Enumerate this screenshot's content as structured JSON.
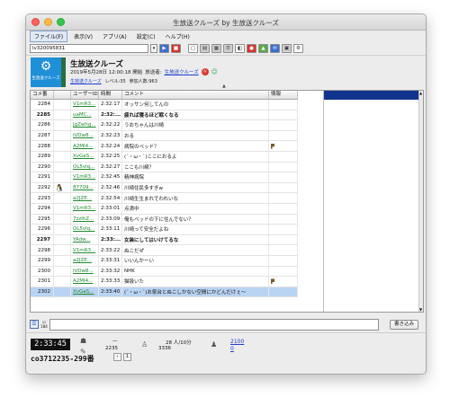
{
  "window": {
    "title": "生放送クルーズ by 生放送クルーズ"
  },
  "menu": [
    "ファイル(F)",
    "表示(V)",
    "アプリ(A)",
    "設定(C)",
    "ヘルプ(H)"
  ],
  "toolbar": {
    "live_id": "lv320095831"
  },
  "program": {
    "title": "生放送クルーズ",
    "thumb_label": "生放送クルーズ",
    "start": "2019年5月28日 12:00:18 開始",
    "broadcaster_label": "放送者:",
    "broadcaster": "生放送クルーズ",
    "community": "生放送クルーズ",
    "level": "レベル:35",
    "viewers": "参加人数:963"
  },
  "table": {
    "headers": [
      "コメ番",
      "ユーザーID",
      "時間",
      "コメント",
      "情報"
    ],
    "rows": [
      {
        "no": "2284",
        "uid": "V1mR3...",
        "time": "2:32:17",
        "comment": "オッサン何してんの",
        "bold": false,
        "mark": false
      },
      {
        "no": "2285",
        "uid": "uaMC...",
        "time": "2:32:...",
        "comment": "疲れば寝るほど眠くなる",
        "bold": true,
        "mark": false
      },
      {
        "no": "2286",
        "uid": "JgZwhg...",
        "time": "2:32:22",
        "comment": "うおちゃんは川崎",
        "bold": false,
        "mark": false
      },
      {
        "no": "2287",
        "uid": "iVDw8...",
        "time": "2:32:23",
        "comment": "おる",
        "bold": false,
        "mark": false
      },
      {
        "no": "2288",
        "uid": "A2MI4...",
        "time": "2:32:24",
        "comment": "病院のベッド？",
        "bold": false,
        "mark": true
      },
      {
        "no": "2289",
        "uid": "XvGaS...",
        "time": "2:32:25",
        "comment": "(´・ω・`)ここにおるよ",
        "bold": false,
        "mark": false
      },
      {
        "no": "2290",
        "uid": "OL5vlq...",
        "time": "2:32:27",
        "comment": "ここも川崎？",
        "bold": false,
        "mark": false
      },
      {
        "no": "2291",
        "uid": "V1mR3...",
        "time": "2:32:45",
        "comment": "精神病院",
        "bold": false,
        "mark": false
      },
      {
        "no": "2292",
        "uid": "87709...",
        "time": "2:32:46",
        "comment": "川崎住民多すぎw",
        "bold": false,
        "mark": false,
        "avatar": true
      },
      {
        "no": "2293",
        "uid": "a2JZE...",
        "time": "2:32:54",
        "comment": "川崎生生まれでわれいな",
        "bold": false,
        "mark": false
      },
      {
        "no": "2294",
        "uid": "V1mR3...",
        "time": "2:33:01",
        "comment": "点滴中",
        "bold": false,
        "mark": false
      },
      {
        "no": "2295",
        "uid": "7zzlhZ...",
        "time": "2:33:09",
        "comment": "俺もベッドの下に住んでない？",
        "bold": false,
        "mark": false
      },
      {
        "no": "2296",
        "uid": "OL5vlq...",
        "time": "2:33:11",
        "comment": "川崎って安全だよね",
        "bold": false,
        "mark": false
      },
      {
        "no": "2297",
        "uid": "YAdw...",
        "time": "2:33:...",
        "comment": "女装にしてはいけてるな",
        "bold": true,
        "mark": false
      },
      {
        "no": "2298",
        "uid": "V1mR3...",
        "time": "2:33:22",
        "comment": "ぬこだぜ",
        "bold": false,
        "mark": false
      },
      {
        "no": "2299",
        "uid": "a2JZE...",
        "time": "2:33:31",
        "comment": "いいんかーい",
        "bold": false,
        "mark": false
      },
      {
        "no": "2300",
        "uid": "iVDw8...",
        "time": "2:33:32",
        "comment": "NHK",
        "bold": false,
        "mark": false
      },
      {
        "no": "2301",
        "uid": "A2MI4...",
        "time": "2:33:33",
        "comment": "猫扱いた",
        "bold": false,
        "mark": true
      },
      {
        "no": "2302",
        "uid": "XvGaS...",
        "time": "2:33:40",
        "comment": "(´・ω・`)お祭台とぬこしかない空間にかどんだけぇ〜",
        "bold": false,
        "mark": false,
        "selected": true
      }
    ]
  },
  "input": {
    "post_label": "書き込み",
    "check_label": "184"
  },
  "status": {
    "clock": "2:33:45",
    "live_no": "co3712235-299番",
    "dash": "—",
    "comments": "2235",
    "visitors_label": "28 人/10分",
    "visitors": "3336",
    "link1": "2100",
    "link2": "0"
  },
  "colors": {
    "accent": "#13348e",
    "selected_row": "#b9d3f2",
    "user_id": "#1e8a2e"
  }
}
